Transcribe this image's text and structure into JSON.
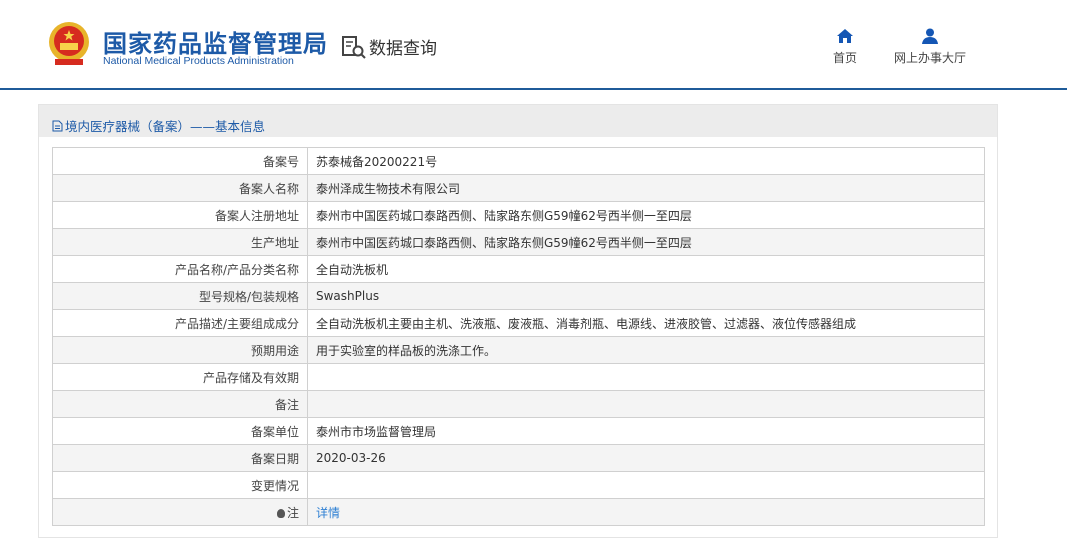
{
  "header": {
    "logo_cn": "国家药品监督管理局",
    "logo_en": "National Medical Products Administration",
    "query_label": "数据查询",
    "nav": [
      {
        "label": "首页",
        "icon": "home-icon"
      },
      {
        "label": "网上办事大厅",
        "icon": "user-icon"
      }
    ]
  },
  "panel": {
    "title": "境内医疗器械（备案）——基本信息"
  },
  "rows": [
    {
      "label": "备案号",
      "value": "苏泰械备20200221号"
    },
    {
      "label": "备案人名称",
      "value": "泰州泽成生物技术有限公司"
    },
    {
      "label": "备案人注册地址",
      "value": "泰州市中国医药城口泰路西侧、陆家路东侧G59幢62号西半侧一至四层"
    },
    {
      "label": "生产地址",
      "value": "泰州市中国医药城口泰路西侧、陆家路东侧G59幢62号西半侧一至四层"
    },
    {
      "label": "产品名称/产品分类名称",
      "value": "全自动洗板机"
    },
    {
      "label": "型号规格/包装规格",
      "value": "SwashPlus"
    },
    {
      "label": "产品描述/主要组成成分",
      "value": "全自动洗板机主要由主机、洗液瓶、废液瓶、消毒剂瓶、电源线、进液胶管、过滤器、液位传感器组成"
    },
    {
      "label": "预期用途",
      "value": "用于实验室的样品板的洗涤工作。"
    },
    {
      "label": "产品存储及有效期",
      "value": ""
    },
    {
      "label": "备注",
      "value": ""
    },
    {
      "label": "备案单位",
      "value": "泰州市市场监督管理局"
    },
    {
      "label": "备案日期",
      "value": "2020-03-26"
    },
    {
      "label": "变更情况",
      "value": ""
    }
  ],
  "note": {
    "label": "注",
    "link": "详情"
  }
}
